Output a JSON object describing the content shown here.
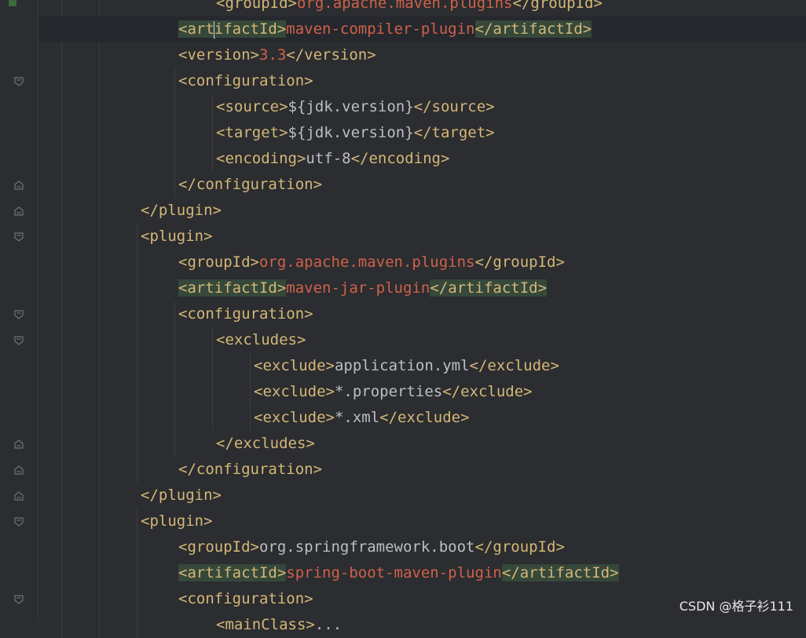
{
  "watermark": "CSDN @格子衫111",
  "lines": [
    {
      "indent": 5,
      "segments": [
        [
          "b",
          "<groupId>"
        ],
        [
          "vr",
          "org.apache.maven.plugins"
        ],
        [
          "b",
          "</groupId>"
        ]
      ],
      "partial": true
    },
    {
      "indent": 4,
      "current": true,
      "segments": [
        [
          "b",
          "<art"
        ],
        [
          "caret",
          ""
        ],
        [
          "b",
          "ifactId>"
        ],
        [
          "vr",
          "maven-compiler-plugin"
        ],
        [
          "b",
          "</artifactId>"
        ]
      ],
      "hl_tags": true
    },
    {
      "indent": 4,
      "segments": [
        [
          "b",
          "<version>"
        ],
        [
          "vr",
          "3.3"
        ],
        [
          "b",
          "</version>"
        ]
      ]
    },
    {
      "indent": 4,
      "segments": [
        [
          "b",
          "<configuration>"
        ]
      ]
    },
    {
      "indent": 5,
      "segments": [
        [
          "b",
          "<source>"
        ],
        [
          "t",
          "${jdk.version}"
        ],
        [
          "b",
          "</source>"
        ]
      ]
    },
    {
      "indent": 5,
      "segments": [
        [
          "b",
          "<target>"
        ],
        [
          "t",
          "${jdk.version}"
        ],
        [
          "b",
          "</target>"
        ]
      ]
    },
    {
      "indent": 5,
      "segments": [
        [
          "b",
          "<encoding>"
        ],
        [
          "t",
          "utf-8"
        ],
        [
          "b",
          "</encoding>"
        ]
      ]
    },
    {
      "indent": 4,
      "segments": [
        [
          "b",
          "</configuration>"
        ]
      ]
    },
    {
      "indent": 3,
      "segments": [
        [
          "b",
          "</plugin>"
        ]
      ]
    },
    {
      "indent": 3,
      "segments": [
        [
          "b",
          "<plugin>"
        ]
      ]
    },
    {
      "indent": 4,
      "segments": [
        [
          "b",
          "<groupId>"
        ],
        [
          "vr",
          "org.apache.maven.plugins"
        ],
        [
          "b",
          "</groupId>"
        ]
      ]
    },
    {
      "indent": 4,
      "segments": [
        [
          "b",
          "<artifactId>"
        ],
        [
          "vr",
          "maven-jar-plugin"
        ],
        [
          "b",
          "</artifactId>"
        ]
      ],
      "hl_tags": true
    },
    {
      "indent": 4,
      "segments": [
        [
          "b",
          "<configuration>"
        ]
      ]
    },
    {
      "indent": 5,
      "segments": [
        [
          "b",
          "<excludes>"
        ]
      ]
    },
    {
      "indent": 6,
      "segments": [
        [
          "b",
          "<exclude>"
        ],
        [
          "t",
          "application.yml"
        ],
        [
          "b",
          "</exclude>"
        ]
      ]
    },
    {
      "indent": 6,
      "segments": [
        [
          "b",
          "<exclude>"
        ],
        [
          "t",
          "*.properties"
        ],
        [
          "b",
          "</exclude>"
        ]
      ]
    },
    {
      "indent": 6,
      "segments": [
        [
          "b",
          "<exclude>"
        ],
        [
          "t",
          "*.xml"
        ],
        [
          "b",
          "</exclude>"
        ]
      ]
    },
    {
      "indent": 5,
      "segments": [
        [
          "b",
          "</excludes>"
        ]
      ]
    },
    {
      "indent": 4,
      "segments": [
        [
          "b",
          "</configuration>"
        ]
      ]
    },
    {
      "indent": 3,
      "segments": [
        [
          "b",
          "</plugin>"
        ]
      ]
    },
    {
      "indent": 3,
      "segments": [
        [
          "b",
          "<plugin>"
        ]
      ]
    },
    {
      "indent": 4,
      "segments": [
        [
          "b",
          "<groupId>"
        ],
        [
          "t",
          "org.springframework.boot"
        ],
        [
          "b",
          "</groupId>"
        ]
      ]
    },
    {
      "indent": 4,
      "segments": [
        [
          "b",
          "<artifactId>"
        ],
        [
          "vr",
          "spring-boot-maven-plugin"
        ],
        [
          "b",
          "</artifactId>"
        ]
      ],
      "hl_tags": true
    },
    {
      "indent": 4,
      "segments": [
        [
          "b",
          "<configuration>"
        ]
      ]
    },
    {
      "indent": 5,
      "segments": [
        [
          "b",
          "<mainClass>"
        ],
        [
          "t",
          "..."
        ]
      ],
      "partial": true
    }
  ],
  "colors": {
    "background": "#2b2d30",
    "tag": "#d5b778",
    "value": "#d0614a",
    "text": "#bcbec4",
    "tag_highlight": "#35483a"
  }
}
